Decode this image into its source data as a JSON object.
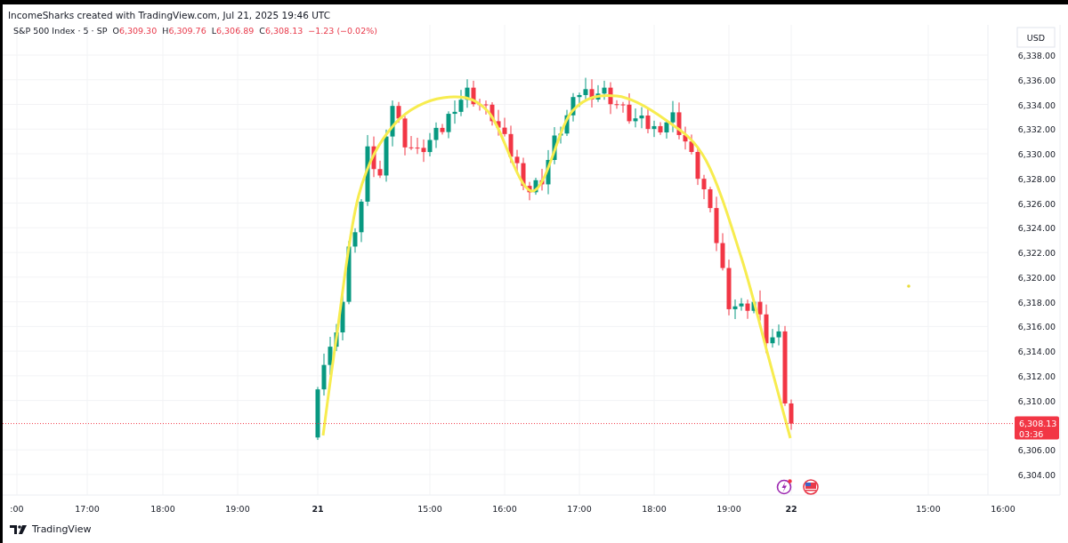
{
  "header": {
    "title": "IncomeSharks created with TradingView.com, Jul 21, 2025 19:46 UTC"
  },
  "legend": {
    "symbol": "S&P 500 Index · 5 · SP",
    "values": [
      {
        "label": "O",
        "value": "6,309.30"
      },
      {
        "label": "H",
        "value": "6,309.76"
      },
      {
        "label": "L",
        "value": "6,306.89"
      },
      {
        "label": "C",
        "value": "6,308.13"
      }
    ],
    "change": "−1.23 (−0.02%)"
  },
  "price_axis": {
    "currency": "USD",
    "ticks": [
      "6,338.00",
      "6,336.00",
      "6,334.00",
      "6,332.00",
      "6,330.00",
      "6,328.00",
      "6,326.00",
      "6,324.00",
      "6,322.00",
      "6,320.00",
      "6,318.00",
      "6,316.00",
      "6,314.00",
      "6,312.00",
      "6,310.00",
      "6,306.00",
      "6,304.00"
    ],
    "last_price": "6,308.13",
    "countdown": "03:36"
  },
  "time_axis": {
    "ticks": [
      {
        "label": ":00",
        "bold": false
      },
      {
        "label": "17:00",
        "bold": false
      },
      {
        "label": "18:00",
        "bold": false
      },
      {
        "label": "19:00",
        "bold": false
      },
      {
        "label": "21",
        "bold": true
      },
      {
        "label": "15:00",
        "bold": false
      },
      {
        "label": "16:00",
        "bold": false
      },
      {
        "label": "17:00",
        "bold": false
      },
      {
        "label": "18:00",
        "bold": false
      },
      {
        "label": "19:00",
        "bold": false
      },
      {
        "label": "22",
        "bold": true
      },
      {
        "label": "15:00",
        "bold": false
      },
      {
        "label": "16:00",
        "bold": false
      }
    ]
  },
  "footer": {
    "brand": "TradingView"
  }
}
